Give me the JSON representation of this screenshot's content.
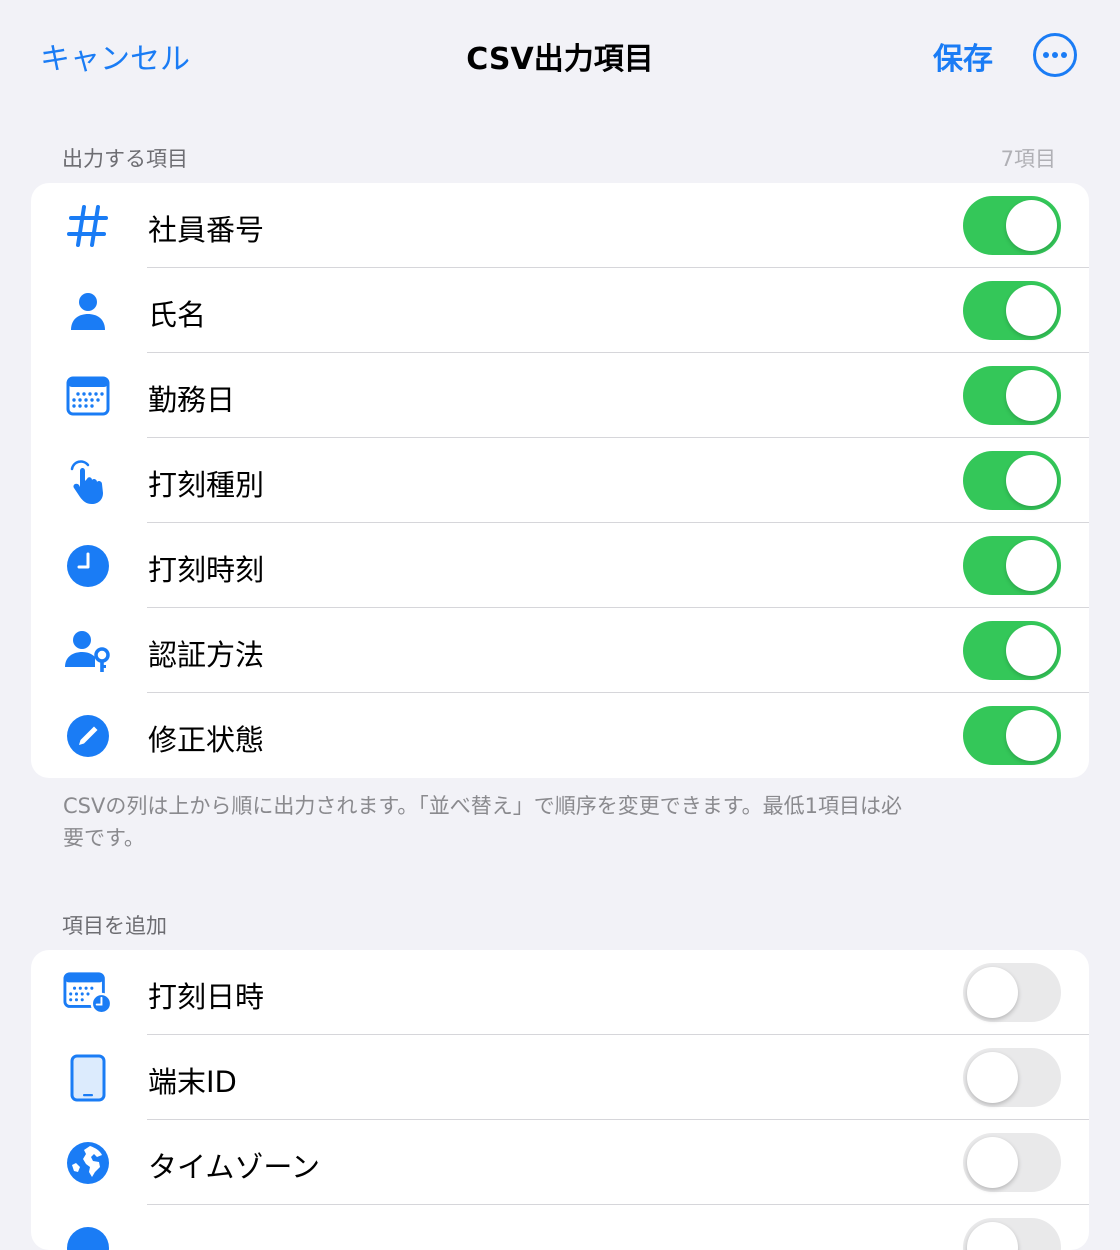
{
  "nav": {
    "cancel_label": "キャンセル",
    "title": "CSV出力項目",
    "save_label": "保存",
    "more_icon": "ellipsis-circle-icon"
  },
  "colors": {
    "accent": "#1a7cf5",
    "toggle_on": "#34c759",
    "toggle_off": "#e9e9ea"
  },
  "output_section": {
    "header": "出力する項目",
    "count": "7項目",
    "items": [
      {
        "label": "社員番号",
        "icon": "number-icon",
        "enabled": true
      },
      {
        "label": "氏名",
        "icon": "person-icon",
        "enabled": true
      },
      {
        "label": "勤務日",
        "icon": "calendar-icon",
        "enabled": true
      },
      {
        "label": "打刻種別",
        "icon": "hand-tap-icon",
        "enabled": true
      },
      {
        "label": "打刻時刻",
        "icon": "clock-icon",
        "enabled": true
      },
      {
        "label": "認証方法",
        "icon": "person-key-icon",
        "enabled": true
      },
      {
        "label": "修正状態",
        "icon": "pencil-circle-icon",
        "enabled": true
      }
    ],
    "footer": "CSVの列は上から順に出力されます。「並べ替え」で順序を変更できます。最低1項目は必要です。"
  },
  "add_section": {
    "header": "項目を追加",
    "items": [
      {
        "label": "打刻日時",
        "icon": "calendar-clock-icon",
        "enabled": false
      },
      {
        "label": "端末ID",
        "icon": "ipad-icon",
        "enabled": false
      },
      {
        "label": "タイムゾーン",
        "icon": "globe-icon",
        "enabled": false
      }
    ]
  }
}
